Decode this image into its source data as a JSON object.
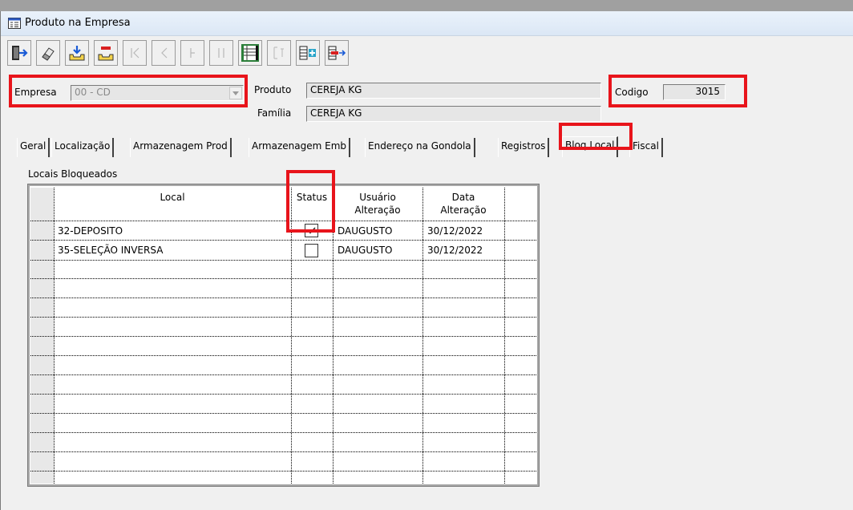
{
  "window": {
    "title": "Produto na Empresa"
  },
  "toolbar": {
    "buttons": [
      {
        "icon": "exit-door-icon",
        "enabled": true
      },
      {
        "icon": "eraser-icon",
        "enabled": true
      },
      {
        "icon": "save-tray-icon",
        "enabled": true
      },
      {
        "icon": "delete-tray-icon",
        "enabled": true
      },
      {
        "icon": "first-record-icon",
        "enabled": false
      },
      {
        "icon": "previous-record-icon",
        "enabled": false
      },
      {
        "icon": "next-record-icon",
        "enabled": false
      },
      {
        "icon": "last-record-icon",
        "enabled": false
      },
      {
        "icon": "grid-list-icon",
        "enabled": true
      },
      {
        "icon": "search-records-icon",
        "enabled": false
      },
      {
        "icon": "add-record-icon",
        "enabled": true
      },
      {
        "icon": "remove-record-icon",
        "enabled": true
      }
    ]
  },
  "form": {
    "empresa_label": "Empresa",
    "empresa_value": "00 - CD",
    "produto_label": "Produto",
    "produto_value": "CEREJA KG",
    "familia_label": "Família",
    "familia_value": "CEREJA KG",
    "codigo_label": "Codigo",
    "codigo_value": "3015"
  },
  "tabs": [
    {
      "label": "Geral",
      "active": false
    },
    {
      "label": "Localização",
      "active": false
    },
    {
      "label": "Armazenagem Prod",
      "active": false
    },
    {
      "label": "Armazenagem Emb",
      "active": false
    },
    {
      "label": "Endereço na Gondola",
      "active": false
    },
    {
      "label": "Registros",
      "active": false
    },
    {
      "label": "Bloq Local",
      "active": true
    },
    {
      "label": "Fiscal",
      "active": false
    }
  ],
  "blocked": {
    "group_label": "Locais Bloqueados",
    "columns": {
      "local": "Local",
      "status": "Status",
      "usuario_1": "Usuário",
      "usuario_2": "Alteração",
      "data_1": "Data",
      "data_2": "Alteração"
    },
    "rows": [
      {
        "local": "32-DEPOSITO",
        "status": true,
        "usuario": "DAUGUSTO",
        "data": "30/12/2022"
      },
      {
        "local": "35-SELEÇÃO INVERSA",
        "status": false,
        "usuario": "DAUGUSTO",
        "data": "30/12/2022"
      }
    ]
  },
  "highlight_color": "#e8141b"
}
